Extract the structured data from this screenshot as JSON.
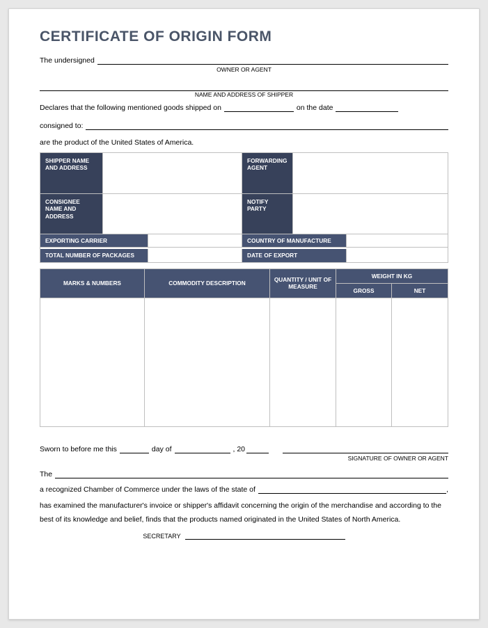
{
  "title": "CERTIFICATE OF ORIGIN FORM",
  "header": {
    "undersigned_label": "The undersigned",
    "owner_or_agent_caption": "OWNER OR AGENT",
    "shipper_caption": "NAME AND ADDRESS OF SHIPPER",
    "declares_prefix": "Declares that the following mentioned goods shipped on",
    "declares_suffix": "on the date",
    "consigned_label": "consigned to:",
    "product_of_text": "are the product of the United States of America."
  },
  "info": {
    "shipper_label": "SHIPPER NAME AND ADDRESS",
    "forwarding_agent_label": "FORWARDING AGENT",
    "consignee_label": "CONSIGNEE NAME AND ADDRESS",
    "notify_party_label": "NOTIFY PARTY",
    "exporting_carrier_label": "EXPORTING CARRIER",
    "country_of_manufacture_label": "COUNTRY OF MANUFACTURE",
    "total_packages_label": "TOTAL NUMBER OF PACKAGES",
    "date_of_export_label": "DATE OF EXPORT"
  },
  "table": {
    "marks_numbers": "MARKS & NUMBERS",
    "commodity_description": "COMMODITY DESCRIPTION",
    "quantity_uom": "QUANTITY / UNIT OF MEASURE",
    "weight_kg": "WEIGHT IN KG",
    "gross": "GROSS",
    "net": "NET"
  },
  "footer": {
    "sworn_prefix": "Sworn to before me this",
    "day_of": "day of",
    "year_prefix": ", 20",
    "signature_caption": "SIGNATURE OF OWNER OR AGENT",
    "the_label": "The",
    "chamber_text": "a recognized Chamber of Commerce under the laws of the state of",
    "examined_text": "has examined the manufacturer's invoice or shipper's affidavit concerning the origin of the merchandise and according to the best of its knowledge and belief, finds that the products named originated in the United States of North America.",
    "secretary_label": "SECRETARY"
  }
}
